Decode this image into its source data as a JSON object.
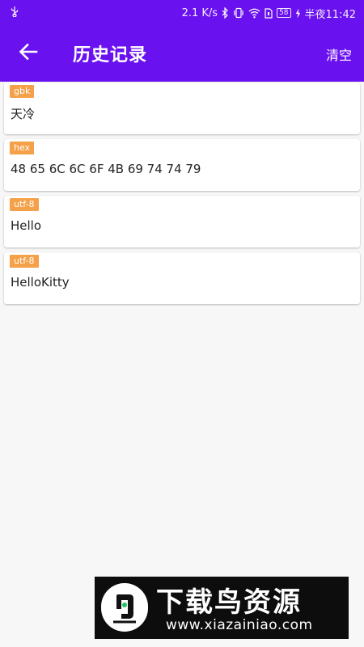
{
  "status_bar": {
    "net_speed": "2.1 K/s",
    "battery": "58",
    "time": "半夜11:42",
    "icons": [
      "usb-icon",
      "bluetooth-icon",
      "vibrate-icon",
      "wifi-icon",
      "sim-icon",
      "battery-icon",
      "charging-icon"
    ]
  },
  "app_bar": {
    "title": "历史记录",
    "back_icon": "arrow-left-icon",
    "clear_label": "清空"
  },
  "history": [
    {
      "encoding": "gbk",
      "text": "天冷"
    },
    {
      "encoding": "hex",
      "text": "48 65 6C 6C 6F 4B 69 74 74 79"
    },
    {
      "encoding": "utf-8",
      "text": "Hello"
    },
    {
      "encoding": "utf-8",
      "text": "HelloKitty"
    }
  ],
  "watermark": {
    "title": "下载鸟资源",
    "url": "www.xiazainiao.com"
  },
  "colors": {
    "primary": "#6a11f0",
    "tag": "#f4a14a",
    "background": "#f7f7f7"
  }
}
